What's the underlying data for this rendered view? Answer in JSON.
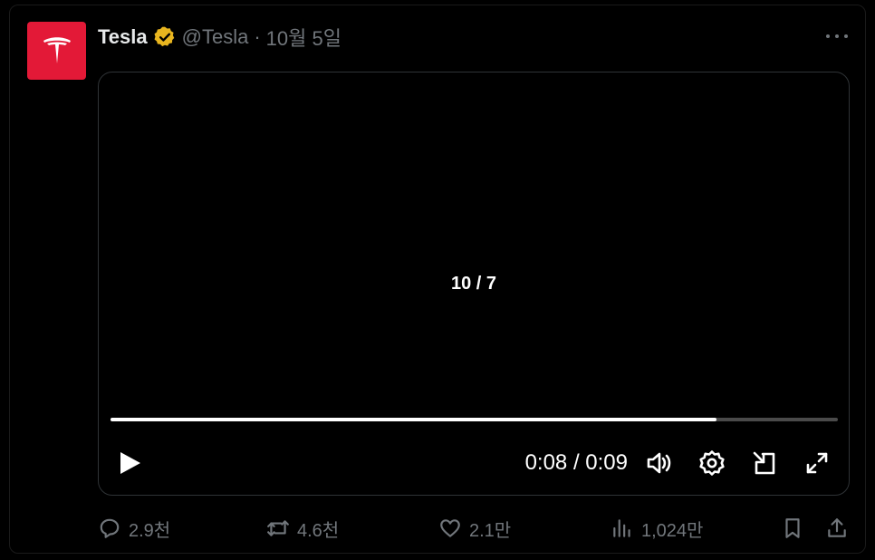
{
  "tweet": {
    "author_name": "Tesla",
    "handle": "@Tesla",
    "separator": "·",
    "date": "10월 5일"
  },
  "video": {
    "counter": "10 / 7",
    "time": "0:08 / 0:09",
    "progress": 0.833
  },
  "actions": {
    "replies": "2.9천",
    "retweets": "4.6천",
    "likes": "2.1만",
    "views": "1,024만"
  },
  "colors": {
    "avatar_bg": "#e31937",
    "verified_badge": "#e8b51f",
    "muted_text": "#71767b"
  },
  "icons": [
    "tesla-logo-icon",
    "verified-badge-icon",
    "more-icon",
    "play-icon",
    "volume-icon",
    "settings-icon",
    "dock-icon",
    "fullscreen-icon",
    "reply-icon",
    "retweet-icon",
    "like-icon",
    "views-icon",
    "bookmark-icon",
    "share-icon"
  ]
}
